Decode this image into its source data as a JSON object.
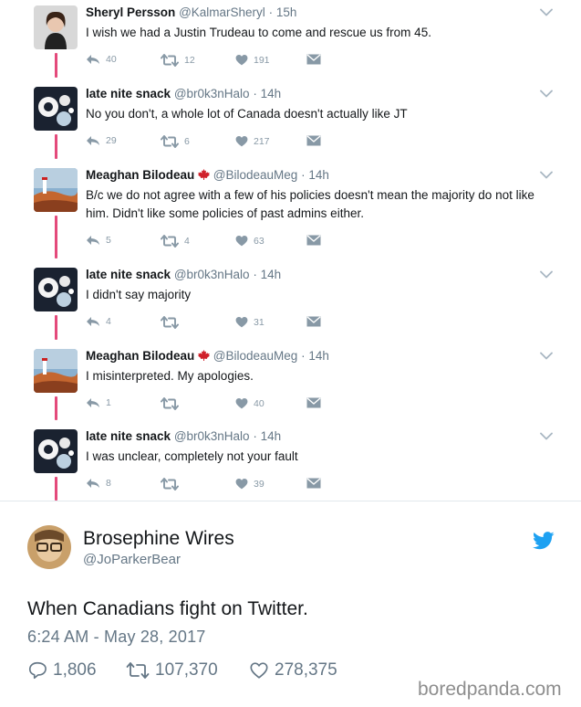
{
  "thread": [
    {
      "name": "Sheryl Persson",
      "flag": false,
      "handle": "@KalmarSheryl",
      "time": "15h",
      "text": "I wish we had a Justin Trudeau to come and rescue us from 45.",
      "replies": "40",
      "retweets": "12",
      "likes": "191",
      "avatar": "sheryl"
    },
    {
      "name": "late nite snack",
      "flag": false,
      "handle": "@br0k3nHalo",
      "time": "14h",
      "text": "No you don't, a whole lot of Canada doesn't actually like JT",
      "replies": "29",
      "retweets": "6",
      "likes": "217",
      "avatar": "snack"
    },
    {
      "name": "Meaghan Bilodeau",
      "flag": true,
      "handle": "@BilodeauMeg",
      "time": "14h",
      "text": "B/c we do not agree with a few of his policies doesn't mean the majority do not like him. Didn't like some policies of past admins either.",
      "replies": "5",
      "retweets": "4",
      "likes": "63",
      "avatar": "meaghan"
    },
    {
      "name": "late nite snack",
      "flag": false,
      "handle": "@br0k3nHalo",
      "time": "14h",
      "text": "I didn't say majority",
      "replies": "4",
      "retweets": "",
      "likes": "31",
      "avatar": "snack"
    },
    {
      "name": "Meaghan Bilodeau",
      "flag": true,
      "handle": "@BilodeauMeg",
      "time": "14h",
      "text": "I misinterpreted. My apologies.",
      "replies": "1",
      "retweets": "",
      "likes": "40",
      "avatar": "meaghan"
    },
    {
      "name": "late nite snack",
      "flag": false,
      "handle": "@br0k3nHalo",
      "time": "14h",
      "text": "I was unclear, completely not your fault",
      "replies": "8",
      "retweets": "",
      "likes": "39",
      "avatar": "snack"
    }
  ],
  "main": {
    "name": "Brosephine Wires",
    "handle": "@JoParkerBear",
    "text": "When Canadians fight on Twitter.",
    "timestamp": "6:24 AM - May 28, 2017",
    "replies": "1,806",
    "retweets": "107,370",
    "likes": "278,375"
  },
  "watermark": "boredpanda.com",
  "colors": {
    "thread_line": "#e44a7b",
    "twitter_blue": "#1da1f2",
    "muted": "#8899a6"
  },
  "icons": [
    "reply-icon",
    "retweet-icon",
    "heart-icon",
    "direct-message-icon",
    "chevron-down-icon",
    "twitter-bird-icon",
    "maple-leaf-icon"
  ]
}
